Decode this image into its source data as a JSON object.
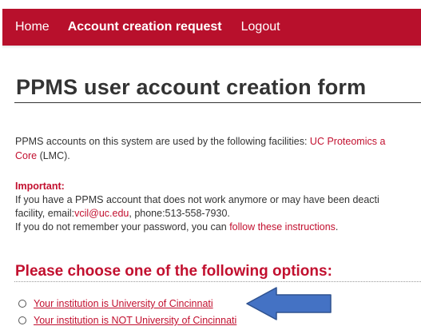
{
  "nav": {
    "home": "Home",
    "account_creation_request": "Account creation request",
    "logout": "Logout"
  },
  "page_title": "PPMS user account creation form",
  "intro": {
    "line1_prefix": "PPMS accounts on this system are used by the following facilities: ",
    "line1_link": "UC Proteomics a",
    "line2_link": "Core",
    "line2_suffix": " (LMC)."
  },
  "important": {
    "heading": "Important:",
    "line1": "If you have a PPMS account that does not work anymore or may have been deacti",
    "line2_prefix": "facility, email:",
    "email": "vcil@uc.edu",
    "line2_suffix": ", phone:513-558-7930.",
    "line3_prefix": "If you do not remember your password, you can ",
    "line3_link": "follow these instructions",
    "line3_suffix": "."
  },
  "options": {
    "heading": "Please choose one of the following options:",
    "items": [
      {
        "label": "Your institution is University of Cincinnati"
      },
      {
        "label": "Your institution is NOT University of Cincinnati"
      }
    ]
  },
  "colors": {
    "navbar": "#b8102c",
    "accent_red": "#c2102f",
    "text": "#333333",
    "annotation_arrow": "#4472c4"
  },
  "annotation": {
    "icon": "arrow-left-icon"
  }
}
